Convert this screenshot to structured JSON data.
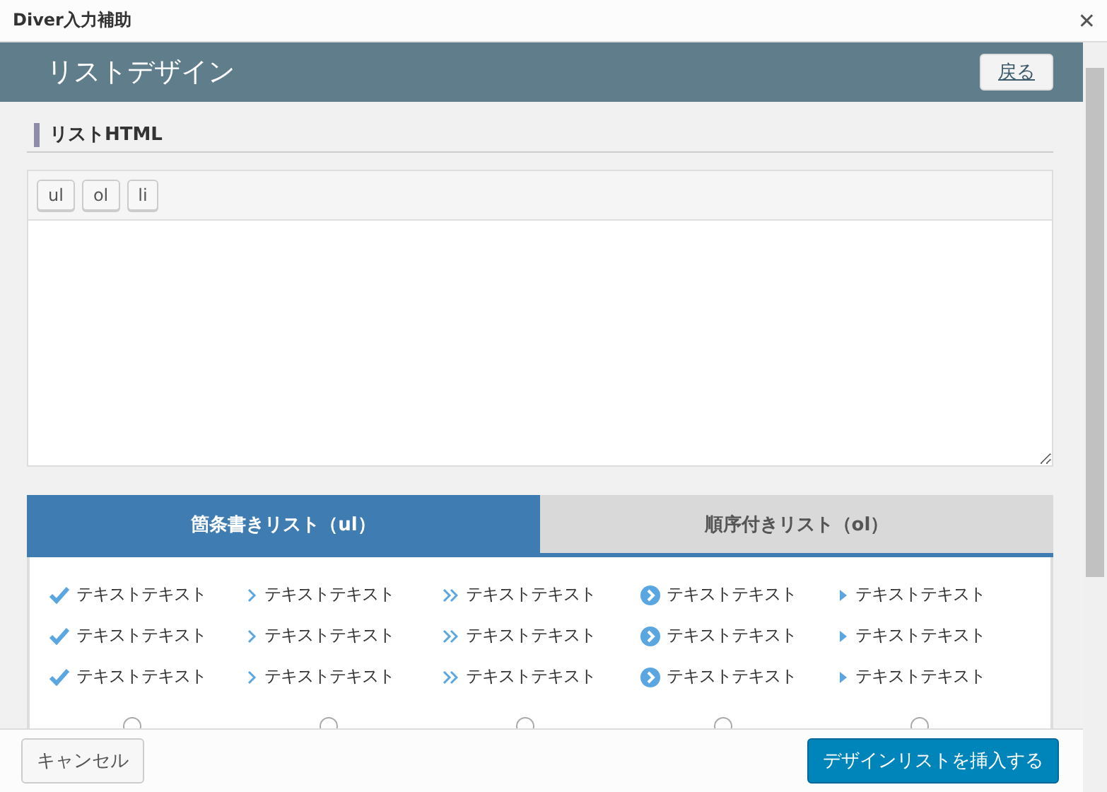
{
  "window": {
    "title": "Diver入力補助",
    "close": "✕"
  },
  "header": {
    "title": "リストデザイン",
    "back": "戻る"
  },
  "section": {
    "title": "リストHTML"
  },
  "editor": {
    "buttons": [
      "ul",
      "ol",
      "li"
    ]
  },
  "tabs": [
    {
      "label": "箇条書きリスト（ul）",
      "selected": true
    },
    {
      "label": "順序付きリスト（ol）",
      "selected": false
    }
  ],
  "styles": [
    {
      "kind": "check",
      "items": [
        "テキストテキスト",
        "テキストテキスト",
        "テキストテキスト"
      ],
      "selected": false
    },
    {
      "kind": "chevron",
      "items": [
        "テキストテキスト",
        "テキストテキスト",
        "テキストテキスト"
      ],
      "selected": false
    },
    {
      "kind": "double-chevron",
      "items": [
        "テキストテキスト",
        "テキストテキスト",
        "テキストテキスト"
      ],
      "selected": false
    },
    {
      "kind": "circle-chevron",
      "items": [
        "テキストテキスト",
        "テキストテキスト",
        "テキストテキスト"
      ],
      "selected": false
    },
    {
      "kind": "triangle",
      "items": [
        "テキストテキスト",
        "テキストテキスト",
        "テキストテキスト"
      ],
      "selected": false
    }
  ],
  "footer": {
    "cancel": "キャンセル",
    "insert": "デザインリストを挿入する"
  }
}
